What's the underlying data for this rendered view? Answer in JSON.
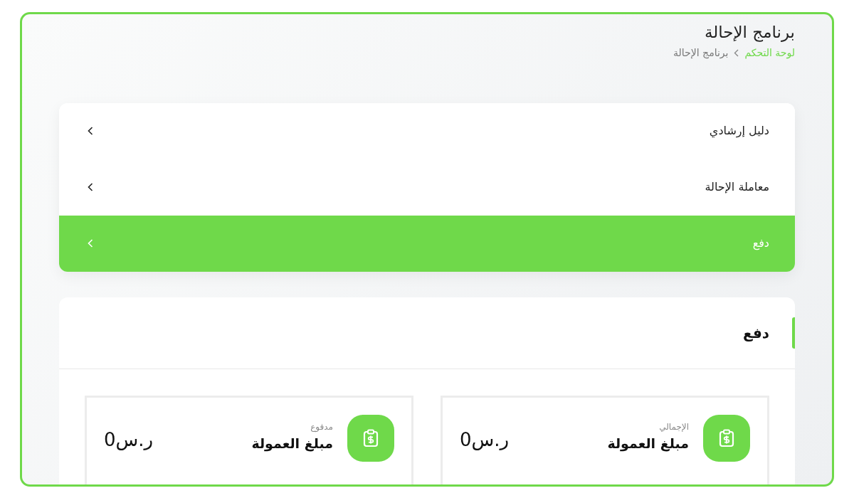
{
  "page": {
    "title": "برنامج الإحالة",
    "breadcrumb": [
      {
        "label": "لوحة التحكم",
        "link": true
      },
      {
        "label": "برنامج الإحالة",
        "link": false
      }
    ]
  },
  "menu": [
    {
      "label": "دليل إرشادي",
      "selected": false
    },
    {
      "label": "معاملة الإحالة",
      "selected": false
    },
    {
      "label": "دفع",
      "selected": true
    }
  ],
  "section": {
    "title": "دفع",
    "stats": [
      {
        "caption": "الإجمالي",
        "label": "مبلغ العمولة",
        "value": "ر.س0"
      },
      {
        "caption": "مدفوع",
        "label": "مبلغ العمولة",
        "value": "ر.س0"
      }
    ]
  }
}
